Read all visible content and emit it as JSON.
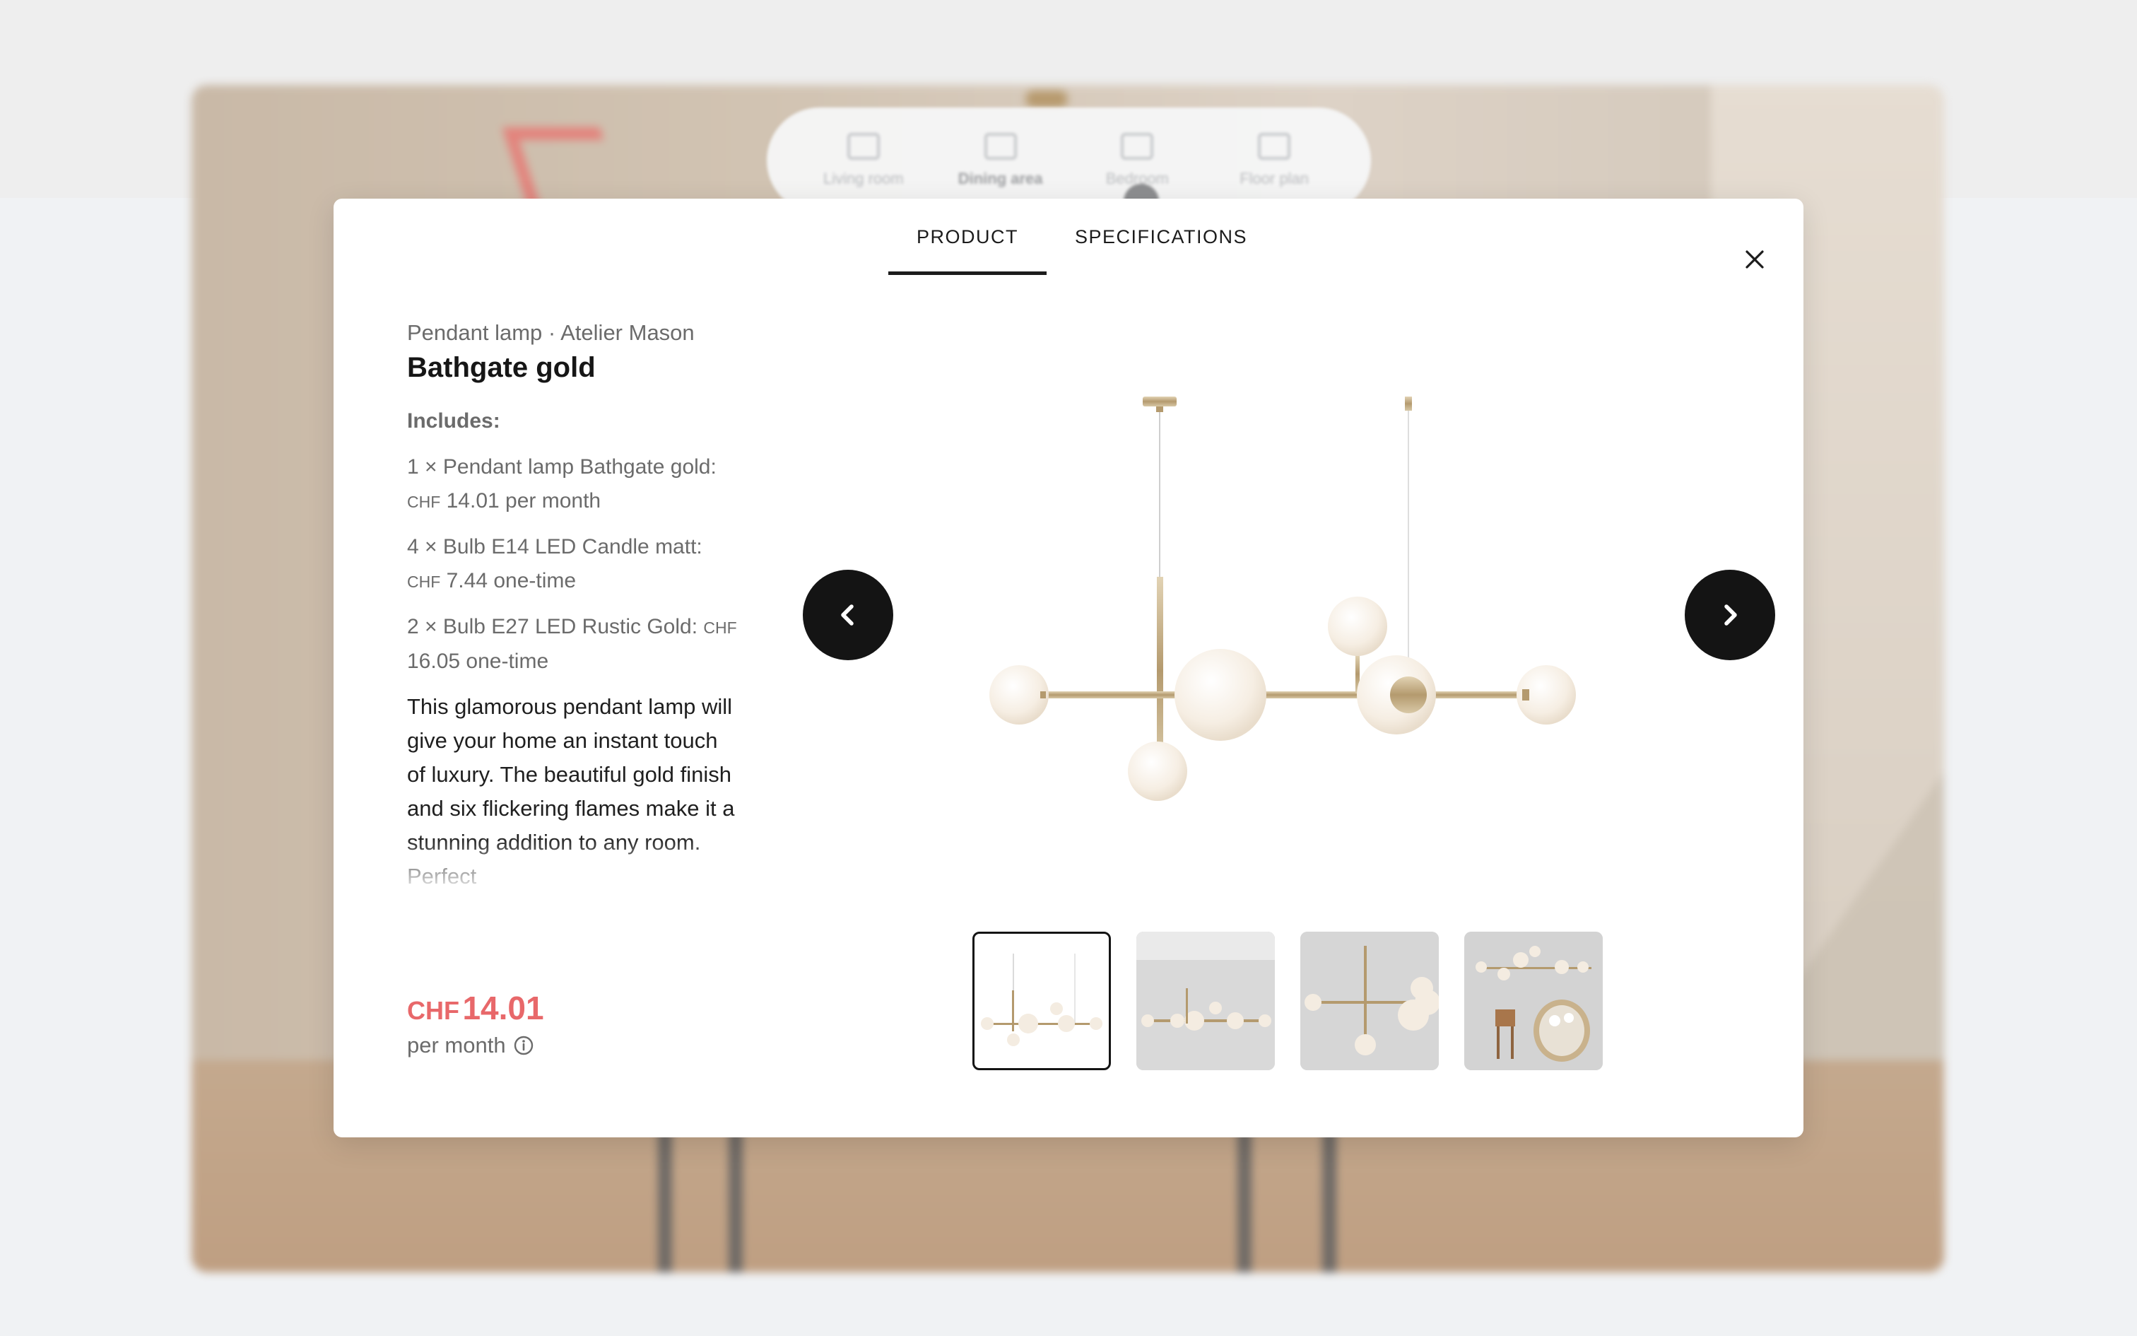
{
  "background_nav": {
    "items": [
      {
        "label": "Living room",
        "icon": "sofa-icon"
      },
      {
        "label": "Dining area",
        "icon": "dining-table-icon"
      },
      {
        "label": "Bedroom",
        "icon": "bed-icon"
      },
      {
        "label": "Floor plan",
        "icon": "floor-plan-icon"
      }
    ]
  },
  "modal": {
    "tabs": [
      {
        "label": "PRODUCT",
        "active": true
      },
      {
        "label": "SPECIFICATIONS",
        "active": false
      }
    ],
    "close_icon": "close-icon"
  },
  "product": {
    "category": "Pendant lamp · Atelier Mason",
    "name": "Bathgate gold",
    "includes_heading": "Includes:",
    "includes": [
      {
        "prefix": "1 × Pendant lamp Bathgate gold: ",
        "currency": "CHF",
        "price": " 14.01 per month"
      },
      {
        "prefix": "4 × Bulb E14 LED Candle matt: ",
        "currency": "CHF",
        "price": " 7.44 one-time"
      },
      {
        "prefix": "2 × Bulb E27 LED Rustic Gold: ",
        "currency": "CHF",
        "price": " 16.05 one-time"
      }
    ],
    "description": "This glamorous pendant lamp will give your home an instant touch of luxury. The beautiful gold finish and six flickering flames make it a stunning addition to any room. Perfect",
    "price_currency": "CHF",
    "price_amount": "14.01",
    "price_period": "per month",
    "info_icon": "info-icon"
  },
  "gallery": {
    "prev_icon": "chevron-left-icon",
    "next_icon": "chevron-right-icon",
    "thumbnails": [
      {
        "name": "thumbnail-1",
        "selected": true
      },
      {
        "name": "thumbnail-2",
        "selected": false
      },
      {
        "name": "thumbnail-3",
        "selected": false
      },
      {
        "name": "thumbnail-4",
        "selected": false
      }
    ]
  },
  "colors": {
    "accent_price": "#e8686a",
    "primary_text": "#161616",
    "muted_text": "#6b6b6b",
    "button_dark": "#141414",
    "lamp_gold": "#c2ae8a",
    "globe": "#f5ede2"
  }
}
